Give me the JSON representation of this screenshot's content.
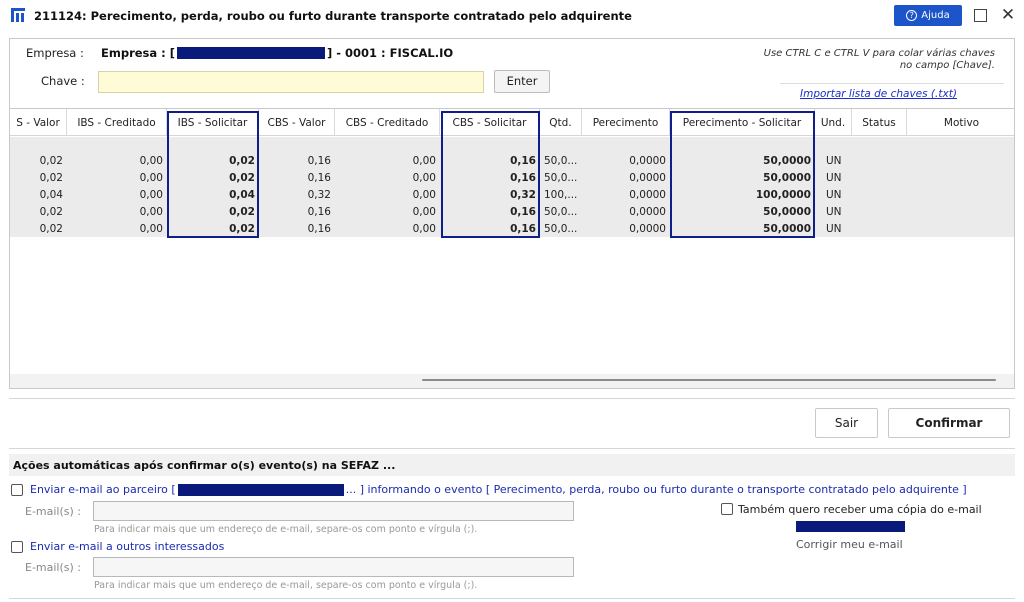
{
  "window": {
    "title": "211124: Perecimento, perda, roubo ou furto durante transporte contratado pelo adquirente",
    "help_label": "Ajuda"
  },
  "header": {
    "empresa_label": "Empresa :",
    "empresa_prefix": "Empresa : [",
    "empresa_suffix": "] - 0001 : FISCAL.IO",
    "chave_label": "Chave :",
    "chave_value": "",
    "enter_label": "Enter",
    "hint": "Use CTRL C e CTRL V para colar várias chaves no campo [Chave].",
    "import_link": "Importar lista de chaves (.txt)"
  },
  "grid": {
    "columns": [
      "S - Valor",
      "IBS - Creditado",
      "IBS - Solicitar",
      "CBS - Valor",
      "CBS - Creditado",
      "CBS - Solicitar",
      "Qtd.",
      "Perecimento",
      "Perecimento - Solicitar",
      "Und.",
      "Status",
      "Motivo"
    ],
    "rows": [
      [
        "0,02",
        "0,00",
        "0,02",
        "0,16",
        "0,00",
        "0,16",
        "50,0...",
        "0,0000",
        "50,0000",
        "UN",
        "",
        ""
      ],
      [
        "0,02",
        "0,00",
        "0,02",
        "0,16",
        "0,00",
        "0,16",
        "50,0...",
        "0,0000",
        "50,0000",
        "UN",
        "",
        ""
      ],
      [
        "0,04",
        "0,00",
        "0,04",
        "0,32",
        "0,00",
        "0,32",
        "100,...",
        "0,0000",
        "100,0000",
        "UN",
        "",
        ""
      ],
      [
        "0,02",
        "0,00",
        "0,02",
        "0,16",
        "0,00",
        "0,16",
        "50,0...",
        "0,0000",
        "50,0000",
        "UN",
        "",
        ""
      ],
      [
        "0,02",
        "0,00",
        "0,02",
        "0,16",
        "0,00",
        "0,16",
        "50,0...",
        "0,0000",
        "50,0000",
        "UN",
        "",
        ""
      ]
    ]
  },
  "buttons": {
    "sair": "Sair",
    "confirmar": "Confirmar"
  },
  "auto_actions": {
    "title": "Ações automáticas após confirmar o(s) evento(s) na SEFAZ ...",
    "partner_prefix": "Enviar e-mail ao parceiro [",
    "partner_suffix": "... ] informando o evento [ Perecimento, perda, roubo ou furto durante o transporte contratado pelo adquirente ]",
    "email_label": "E-mail(s) :",
    "email_hint": "Para indicar mais que um endereço de e-mail, separe-os com ponto e vírgula (;).",
    "others_label": "Enviar e-mail a outros interessados",
    "copy_label": "Também quero receber uma cópia do e-mail",
    "fix_email": "Corrigir meu e-mail"
  },
  "colors": {
    "accent": "#1c54c9",
    "highlight_border": "#0f1f8a",
    "redaction": "#0a1a7a",
    "link": "#1a2bb0"
  }
}
